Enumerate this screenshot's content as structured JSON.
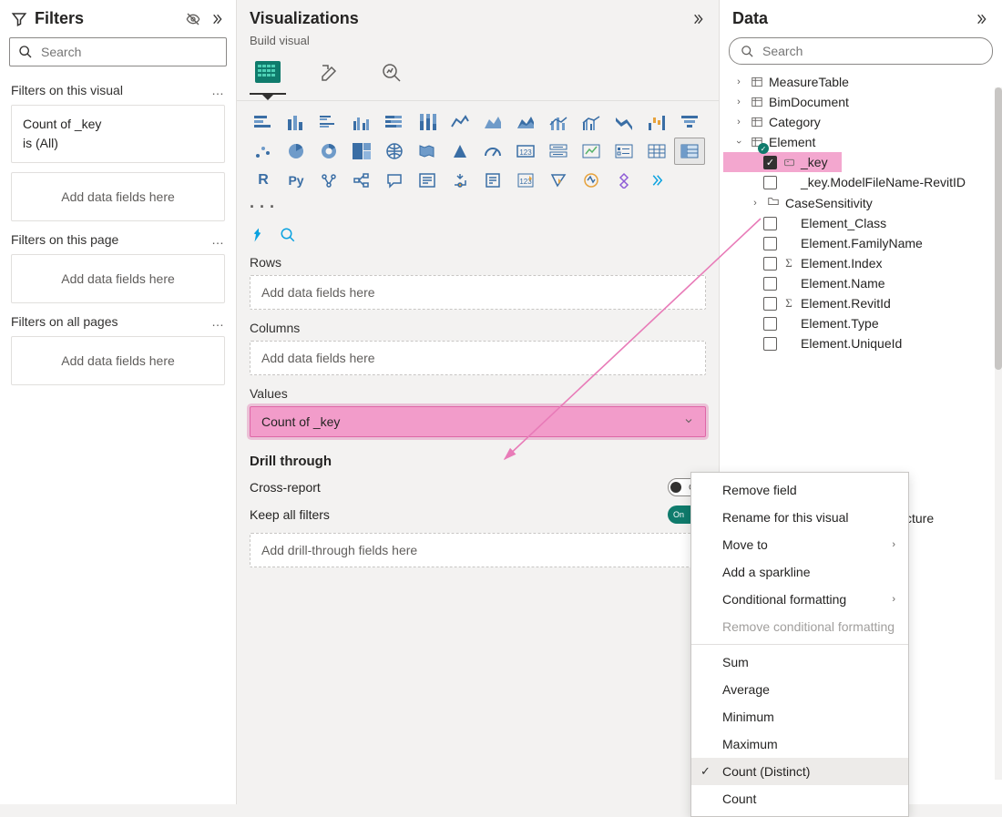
{
  "filters": {
    "title": "Filters",
    "search_placeholder": "Search",
    "section_visual": "Filters on this visual",
    "card_line1": "Count of _key",
    "card_line2": "is (All)",
    "add_fields": "Add data fields here",
    "section_page": "Filters on this page",
    "section_all": "Filters on all pages"
  },
  "viz": {
    "title": "Visualizations",
    "build_label": "Build visual",
    "ellipsis": "· · ·",
    "rows_label": "Rows",
    "rows_placeholder": "Add data fields here",
    "cols_label": "Columns",
    "cols_placeholder": "Add data fields here",
    "values_label": "Values",
    "value_field": "Count of _key",
    "drill_title": "Drill through",
    "cross_report": "Cross-report",
    "cross_off": "Off",
    "keep_filters": "Keep all filters",
    "keep_on": "On",
    "drill_placeholder": "Add drill-through fields here"
  },
  "data": {
    "title": "Data",
    "search_placeholder": "Search",
    "tables": {
      "measure": "MeasureTable",
      "bim": "BimDocument",
      "category": "Category",
      "element": "Element",
      "structure": "cture"
    },
    "fields": {
      "key": "_key",
      "key_model": "_key.ModelFileName-RevitID",
      "case": "CaseSensitivity",
      "class": "Element_Class",
      "family": "Element.FamilyName",
      "index": "Element.Index",
      "name": "Element.Name",
      "revit": "Element.RevitId",
      "type": "Element.Type",
      "unique": "Element.UniqueId"
    }
  },
  "menu": {
    "remove": "Remove field",
    "rename": "Rename for this visual",
    "move": "Move to",
    "spark": "Add a sparkline",
    "cond": "Conditional formatting",
    "remove_cond": "Remove conditional formatting",
    "sum": "Sum",
    "avg": "Average",
    "min": "Minimum",
    "max": "Maximum",
    "count_d": "Count (Distinct)",
    "count": "Count"
  }
}
